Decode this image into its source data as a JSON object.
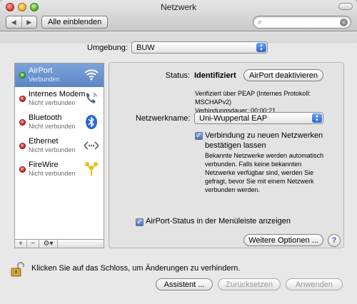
{
  "window": {
    "title": "Netzwerk"
  },
  "toolbar": {
    "back_glyph": "◀",
    "forward_glyph": "▶",
    "show_all": "Alle einblenden",
    "search_value": ""
  },
  "location": {
    "label": "Umgebung:",
    "value": "BUW"
  },
  "services": [
    {
      "name": "AirPort",
      "status": "Verbunden",
      "state": "green",
      "icon": "wifi-icon"
    },
    {
      "name": "Internes Modem",
      "status": "Nicht verbunden",
      "state": "red",
      "icon": "phone-icon"
    },
    {
      "name": "Bluetooth",
      "status": "Nicht verbunden",
      "state": "red",
      "icon": "bluetooth-icon"
    },
    {
      "name": "Ethernet",
      "status": "Nicht verbunden",
      "state": "red",
      "icon": "ethernet-icon"
    },
    {
      "name": "FireWire",
      "status": "Nicht verbunden",
      "state": "red",
      "icon": "firewire-icon"
    }
  ],
  "sidebar_buttons": {
    "add": "+",
    "remove": "−",
    "action": "⚙▾"
  },
  "detail": {
    "status_label": "Status:",
    "status_value": "Identifiziert",
    "airport_off_button": "AirPort deaktivieren",
    "verification": "Verifiziert über PEAP (Internes Protokoll: MSCHAPv2)",
    "duration": "Verbindungsdauer: 00:00:21",
    "network_label": "Netzwerkname:",
    "network_value": "Uni-Wuppertal EAP",
    "ask_join_label": "Verbindung zu neuen Netzwerken bestätigen lassen",
    "ask_join_checked": true,
    "ask_join_desc": "Bekannte Netzwerke werden automatisch verbunden. Falls keine bekannten Netzwerke verfügbar sind, werden Sie gefragt, bevor Sie mit einem Netzwerk verbunden werden.",
    "menubar_label": "AirPort-Status in der Menüleiste anzeigen",
    "menubar_checked": true,
    "advanced_button": "Weitere Optionen ...",
    "help": "?"
  },
  "footer": {
    "lock_text": "Klicken Sie auf das Schloss, um Änderungen zu verhindern.",
    "assistant_button": "Assistent ...",
    "revert_button": "Zurücksetzen",
    "apply_button": "Anwenden"
  },
  "colors": {
    "selection": "#6a92cf",
    "accent": "#3e74d3"
  }
}
